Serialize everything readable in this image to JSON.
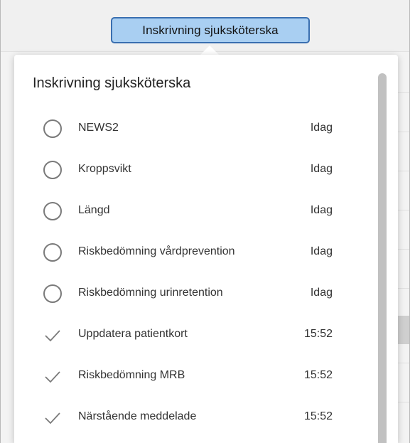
{
  "header": {
    "tab_label": "Inskrivning sjuksköterska"
  },
  "popover": {
    "title": "Inskrivning sjuksköterska",
    "tasks": [
      {
        "label": "NEWS2",
        "time": "Idag",
        "status": "pending",
        "icon": "circle-icon"
      },
      {
        "label": "Kroppsvikt",
        "time": "Idag",
        "status": "pending",
        "icon": "circle-icon"
      },
      {
        "label": "Längd",
        "time": "Idag",
        "status": "pending",
        "icon": "circle-icon"
      },
      {
        "label": "Riskbedömning vårdprevention",
        "time": "Idag",
        "status": "pending",
        "icon": "circle-icon"
      },
      {
        "label": "Riskbedömning urinretention",
        "time": "Idag",
        "status": "pending",
        "icon": "circle-icon"
      },
      {
        "label": "Uppdatera patientkort",
        "time": "15:52",
        "status": "done",
        "icon": "checkmark-icon"
      },
      {
        "label": "Riskbedömning MRB",
        "time": "15:52",
        "status": "done",
        "icon": "checkmark-icon"
      },
      {
        "label": "Närstående meddelade",
        "time": "15:52",
        "status": "done",
        "icon": "checkmark-icon"
      }
    ]
  },
  "colors": {
    "tab_bg": "#a9cff2",
    "tab_border": "#3a6fb0",
    "icon_gray": "#7a7a7a"
  }
}
